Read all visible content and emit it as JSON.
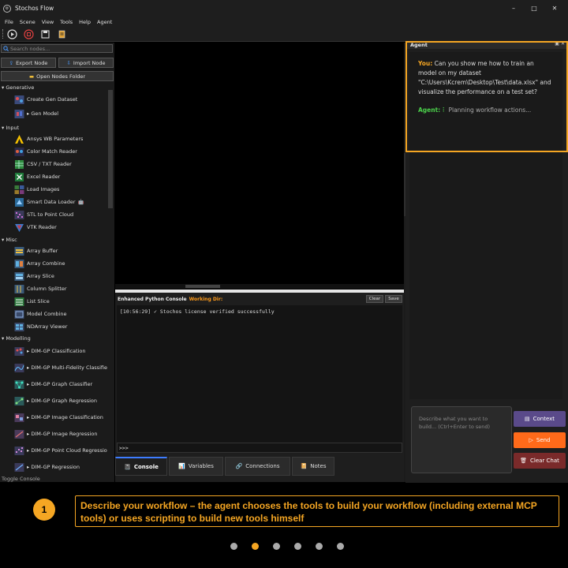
{
  "window": {
    "title": "Stochos Flow",
    "controls": [
      "–",
      "□",
      "✕"
    ]
  },
  "menu": [
    "File",
    "Scene",
    "View",
    "Tools",
    "Help",
    "Agent"
  ],
  "toolbar": {
    "icons": [
      "play-icon",
      "stop-icon",
      "save-icon",
      "notebook-icon"
    ]
  },
  "sidebar": {
    "search_placeholder": "Search nodes...",
    "export_label": "Export Node",
    "import_label": "Import Node",
    "open_folder_label": "Open Nodes Folder",
    "categories": [
      {
        "name": "Generative",
        "items": [
          "Create Gen Dataset",
          "▸ Gen Model"
        ]
      },
      {
        "name": "Input",
        "items": [
          "Ansys WB Parameters",
          "Color Match Reader",
          "CSV / TXT Reader",
          "Excel Reader",
          "Load Images",
          "Smart Data Loader",
          "STL to Point Cloud",
          "VTK Reader"
        ]
      },
      {
        "name": "Misc",
        "items": [
          "Array Buffer",
          "Array Combine",
          "Array Slice",
          "Column Splitter",
          "List Slice",
          "Model Combine",
          "NDArray Viewer"
        ]
      },
      {
        "name": "Modelling",
        "items": [
          "▸ DIM-GP Classification",
          "▸ DIM-GP Multi-Fidelity Classifier",
          "▸ DIM-GP Graph Classifier",
          "▸ DIM-GP Graph Regression",
          "▸ DIM-GP Image Classification",
          "▸ DIM-GP Image Regression",
          "▸ DIM-GP Point Cloud Regression",
          "▸ DIM-GP Regression"
        ]
      }
    ],
    "smart_loader_badge": "🤖",
    "footer_label": "Toggle Console"
  },
  "console": {
    "title": "Enhanced Python Console",
    "working_dir": "Working Dir:",
    "clear_label": "Clear",
    "save_label": "Save",
    "log_line": "[10:56:29] ✓ Stochos license verified successfully",
    "prompt": ">>>",
    "tabs": [
      {
        "label": "Console",
        "icon": "📓"
      },
      {
        "label": "Variables",
        "icon": "📊"
      },
      {
        "label": "Connections",
        "icon": "🔗"
      },
      {
        "label": "Notes",
        "icon": "📔"
      }
    ]
  },
  "agent": {
    "panel_title": "Agent",
    "you_label": "You:",
    "user_message": "Can you show me how to train an model on my dataset \"C:\\Users\\Kcrem\\Desktop\\Test\\data.xlsx\" and visualize the performance on a test set?",
    "agent_label": "Agent:",
    "agent_status": "Planning workflow actions...",
    "input_placeholder": "Describe what you want to build... (Ctrl+Enter to send)",
    "context_label": "Context",
    "send_label": "Send",
    "clear_label": "Clear Chat",
    "colors": {
      "context": "#5a4a8a",
      "send": "#ff6a1a",
      "clear": "#7a2a2a"
    }
  },
  "caption": {
    "step": "1",
    "text": "Describe your workflow – the agent chooses the tools to build your workflow (including external MCP tools) or uses scripting to build new tools himself"
  },
  "pagination": {
    "total": 6,
    "active_index": 1
  },
  "colors": {
    "accent": "#f5a623",
    "agent_green": "#4bd14b"
  }
}
